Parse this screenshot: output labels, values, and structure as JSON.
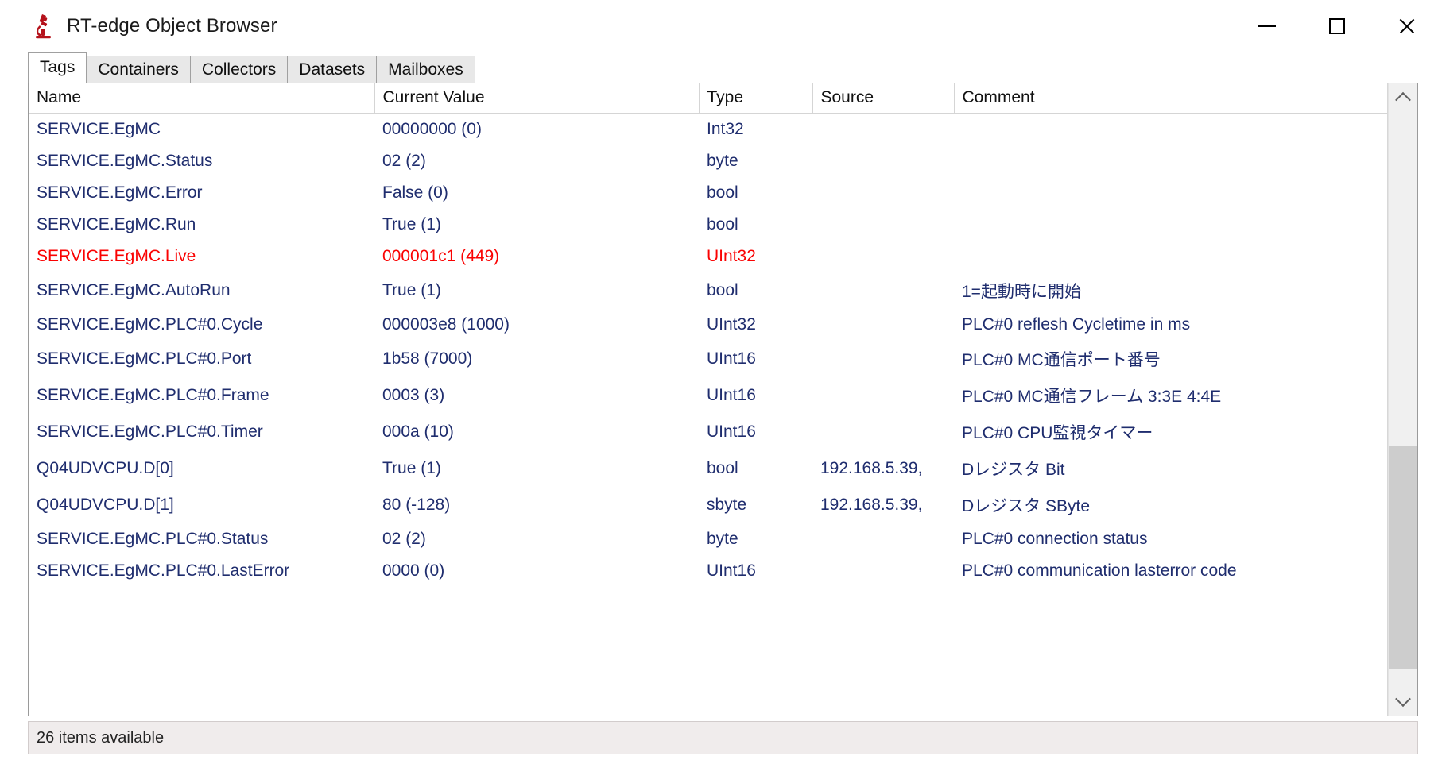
{
  "window": {
    "title": "RT-edge Object Browser",
    "icon": "microscope-icon",
    "controls": {
      "minimize": "minimize-icon",
      "maximize": "maximize-icon",
      "close": "close-icon"
    }
  },
  "tabs": [
    {
      "label": "Tags",
      "active": true
    },
    {
      "label": "Containers",
      "active": false
    },
    {
      "label": "Collectors",
      "active": false
    },
    {
      "label": "Datasets",
      "active": false
    },
    {
      "label": "Mailboxes",
      "active": false
    }
  ],
  "grid": {
    "columns": [
      "Name",
      "Current Value",
      "Type",
      "Source",
      "Comment"
    ],
    "rows": [
      {
        "name": "SERVICE.EgMC",
        "value": "00000000 (0)",
        "type": "Int32",
        "source": "",
        "comment": "",
        "highlight": false
      },
      {
        "name": "SERVICE.EgMC.Status",
        "value": "02 (2)",
        "type": "byte",
        "source": "",
        "comment": "",
        "highlight": false
      },
      {
        "name": "SERVICE.EgMC.Error",
        "value": "False (0)",
        "type": "bool",
        "source": "",
        "comment": "",
        "highlight": false
      },
      {
        "name": "SERVICE.EgMC.Run",
        "value": "True (1)",
        "type": "bool",
        "source": "",
        "comment": "",
        "highlight": false
      },
      {
        "name": "SERVICE.EgMC.Live",
        "value": "000001c1 (449)",
        "type": "UInt32",
        "source": "",
        "comment": "",
        "highlight": true
      },
      {
        "name": "SERVICE.EgMC.AutoRun",
        "value": "True (1)",
        "type": "bool",
        "source": "",
        "comment": "1=起動時に開始",
        "highlight": false
      },
      {
        "name": "SERVICE.EgMC.PLC#0.Cycle",
        "value": "000003e8 (1000)",
        "type": "UInt32",
        "source": "",
        "comment": "PLC#0 reflesh Cycletime in ms",
        "highlight": false
      },
      {
        "name": "SERVICE.EgMC.PLC#0.Port",
        "value": "1b58 (7000)",
        "type": "UInt16",
        "source": "",
        "comment": "PLC#0 MC通信ポート番号",
        "highlight": false
      },
      {
        "name": "SERVICE.EgMC.PLC#0.Frame",
        "value": "0003 (3)",
        "type": "UInt16",
        "source": "",
        "comment": "PLC#0 MC通信フレーム 3:3E  4:4E",
        "highlight": false
      },
      {
        "name": "SERVICE.EgMC.PLC#0.Timer",
        "value": "000a (10)",
        "type": "UInt16",
        "source": "",
        "comment": "PLC#0 CPU監視タイマー",
        "highlight": false
      },
      {
        "name": "Q04UDVCPU.D[0]",
        "value": "True (1)",
        "type": "bool",
        "source": "192.168.5.39,",
        "comment": "Dレジスタ Bit",
        "highlight": false
      },
      {
        "name": "Q04UDVCPU.D[1]",
        "value": "80 (-128)",
        "type": "sbyte",
        "source": "192.168.5.39,",
        "comment": "Dレジスタ SByte",
        "highlight": false
      },
      {
        "name": "SERVICE.EgMC.PLC#0.Status",
        "value": "02 (2)",
        "type": "byte",
        "source": "",
        "comment": "PLC#0 connection status",
        "highlight": false
      },
      {
        "name": "SERVICE.EgMC.PLC#0.LastError",
        "value": "0000 (0)",
        "type": "UInt16",
        "source": "",
        "comment": "PLC#0 communication lasterror code",
        "highlight": false
      }
    ],
    "scrollbar": {
      "up_icon": "chevron-up-icon",
      "down_icon": "chevron-down-icon"
    }
  },
  "statusbar": {
    "text": "26 items available"
  },
  "colors": {
    "row_text": "#1f2d6e",
    "row_highlight": "#fa0202",
    "accent_icon": "#b5121b",
    "status_bg": "#f0ecec"
  }
}
